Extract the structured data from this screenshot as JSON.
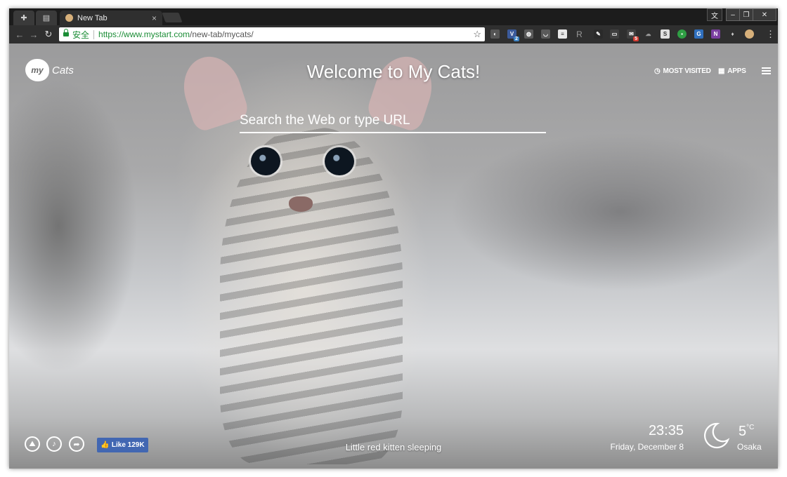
{
  "browser": {
    "tab_active_title": "New Tab",
    "tab_close": "×",
    "window_controls": {
      "ime": "文",
      "minimize": "–",
      "restore": "❐",
      "close": "✕"
    },
    "address": {
      "secure_label": "安全",
      "url_host": "https://www.mystart.com",
      "url_path": "/new-tab/mycats/"
    },
    "extension_badges": {
      "vpn": "2",
      "mail": "5"
    }
  },
  "page": {
    "logo_mark": "my",
    "logo_text": "Cats",
    "welcome": "Welcome to My Cats!",
    "search_placeholder": "Search the Web or type URL",
    "most_visited": "MOST VISITED",
    "apps": "APPS",
    "like_label": "Like 129K",
    "caption": "Little red kitten sleeping",
    "time": "23:35",
    "date": "Friday, December 8",
    "temperature": "5",
    "temperature_unit": "°C",
    "city": "Osaka"
  },
  "icons": [
    "puzzle-icon",
    "calendar-icon",
    "back-icon",
    "forward-icon",
    "reload-icon",
    "lock-icon",
    "star-icon",
    "moon-icon",
    "like-thumb-icon",
    "share-icon",
    "music-icon",
    "landscape-icon",
    "menu-icon",
    "grid-icon",
    "clock-icon"
  ],
  "colors": {
    "secure_green": "#1b8d36",
    "facebook_blue": "#4267b2",
    "chrome_dark": "#2f2f2f"
  }
}
